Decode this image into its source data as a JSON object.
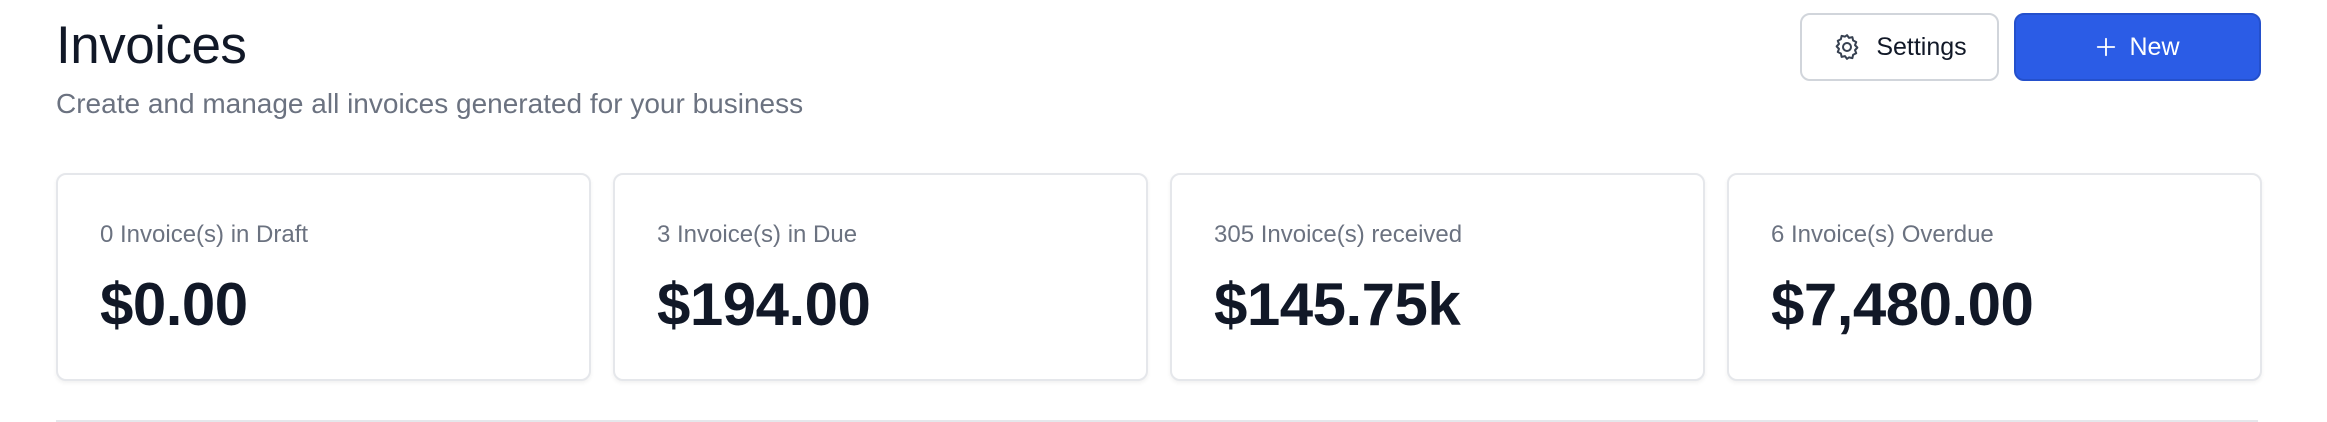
{
  "header": {
    "title": "Invoices",
    "subtitle": "Create and manage all invoices generated for your business"
  },
  "actions": {
    "settings_label": "Settings",
    "settings_icon": "gear-icon",
    "new_label": "New",
    "new_icon": "plus-icon",
    "primary_color": "#2b5ce6"
  },
  "stats": [
    {
      "label": "0 Invoice(s) in Draft",
      "value": "$0.00"
    },
    {
      "label": "3 Invoice(s) in Due",
      "value": "$194.00"
    },
    {
      "label": "305 Invoice(s) received",
      "value": "$145.75k"
    },
    {
      "label": "6 Invoice(s) Overdue",
      "value": "$7,480.00"
    }
  ]
}
